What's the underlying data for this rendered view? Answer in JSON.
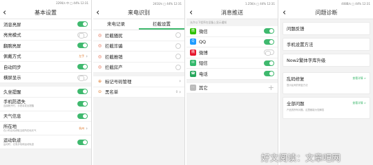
{
  "screen1": {
    "status": "2290/s 中 □ 44% 12:31",
    "title": "基本设置",
    "rows": [
      {
        "label": "消息亮屏",
        "on": true
      },
      {
        "label": "亮亮模式",
        "on": false
      },
      {
        "label": "翻腕亮屏",
        "on": true
      },
      {
        "label": "佩戴方式",
        "value": "左手"
      },
      {
        "label": "自动同步",
        "on": true
      },
      {
        "label": "横屏显示",
        "on": false
      }
    ],
    "rows2": [
      {
        "label": "久坐提醒",
        "on": true
      },
      {
        "label": "手机防遗失",
        "sub": "连接断开时，手表将发出提醒",
        "on": true
      },
      {
        "label": "天气信息",
        "on": true
      },
      {
        "label": "所在地",
        "sub": "在小时自动获取当前所在地天气",
        "value": "杭州"
      },
      {
        "label": "运动轨迹",
        "sub": "运动时，记录步伐和运动轨迹",
        "on": true
      }
    ]
  },
  "screen2": {
    "status": "2410/s □ 44% 12:31",
    "title": "来电识别",
    "tabs": [
      "来电记录",
      "拦截设置"
    ],
    "rows": [
      {
        "icon": "◎",
        "label": "拦截骚扰"
      },
      {
        "icon": "◎",
        "label": "拦截诈骗"
      },
      {
        "icon": "◎",
        "label": "拦截推销"
      },
      {
        "icon": "◎",
        "label": "拦截房产"
      }
    ],
    "rows2": [
      {
        "icon": "⊕",
        "label": "标记号码管理"
      },
      {
        "icon": "⊝",
        "label": "黑名单",
        "value": "0"
      }
    ]
  },
  "screen3": {
    "status": "1.25K/s □ 44% 12:31",
    "title": "消息推送",
    "hint": "允许以下程序在设备上显示通知",
    "apps": [
      {
        "label": "微信",
        "on": true,
        "color": "#2dc100",
        "glyph": "微"
      },
      {
        "label": "QQ",
        "on": true,
        "color": "#1e9bff",
        "glyph": "Q"
      },
      {
        "label": "微博",
        "on": false,
        "color": "#e6162d",
        "glyph": "微"
      },
      {
        "label": "短信",
        "on": true,
        "color": "#33b86b",
        "glyph": "✉"
      },
      {
        "label": "电话",
        "on": true,
        "color": "#26a65b",
        "glyph": "☎"
      }
    ],
    "other": {
      "label": "其它",
      "plus": "+"
    }
  },
  "screen4": {
    "status": "408B/s □ 44% 12:31",
    "title": "问题诊断",
    "cards": [
      {
        "title": "问题反馈"
      },
      {
        "title": "手机设置方法"
      },
      {
        "title": "Now2繁体字库升级"
      },
      {
        "title": "乱码修复",
        "sub": "显示乱码的修复方法",
        "link": "查看详情 >"
      },
      {
        "title": "全部问题",
        "sub": "产品的所有问题，这里都能为您解答",
        "link": "查看详情 >"
      }
    ]
  },
  "watermark": "好文阅读：文章吧网"
}
